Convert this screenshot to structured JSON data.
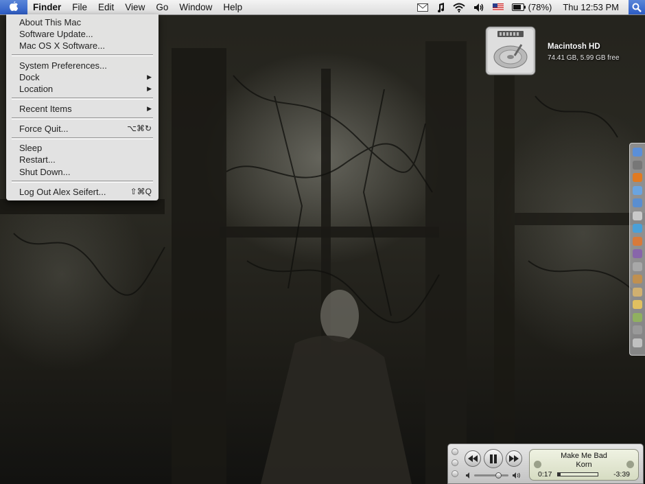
{
  "menubar": {
    "apple_icon": "apple-icon",
    "app_name": "Finder",
    "menus": [
      "File",
      "Edit",
      "View",
      "Go",
      "Window",
      "Help"
    ],
    "extras": {
      "mail_icon": "mail-icon",
      "music_icon": "music-note-icon",
      "wifi_icon": "wifi-icon",
      "volume_icon": "volume-icon",
      "flag_icon": "us-flag-icon",
      "battery_icon": "battery-icon",
      "battery_percent": "(78%)",
      "clock": "Thu 12:53 PM",
      "spotlight_icon": "spotlight-icon"
    }
  },
  "apple_menu": {
    "items": [
      {
        "label": "About This Mac"
      },
      {
        "label": "Software Update..."
      },
      {
        "label": "Mac OS X Software..."
      },
      {
        "label": "System Preferences..."
      },
      {
        "label": "Dock",
        "submenu": true
      },
      {
        "label": "Location",
        "submenu": true
      },
      {
        "label": "Recent Items",
        "submenu": true
      },
      {
        "label": "Force Quit...",
        "shortcut": "⌥⌘↻"
      },
      {
        "label": "Sleep"
      },
      {
        "label": "Restart..."
      },
      {
        "label": "Shut Down..."
      },
      {
        "label": "Log Out Alex Seifert...",
        "shortcut": "⇧⌘Q"
      }
    ]
  },
  "desktop": {
    "hd_name": "Macintosh HD",
    "hd_info": "74.41 GB, 5.99 GB free",
    "hd_icon": "hard-drive-icon"
  },
  "dock": {
    "icons": [
      "finder-icon",
      "system-icon",
      "firefox-icon",
      "safari-icon",
      "mail-icon",
      "ical-icon",
      "itunes-icon",
      "app-icon",
      "app-icon",
      "app-icon",
      "app-icon",
      "app-icon",
      "app-icon",
      "app-icon",
      "app-icon",
      "trash-icon"
    ],
    "colors": [
      "#5b8fd8",
      "#777777",
      "#e07a22",
      "#6aa4e0",
      "#5a8ed0",
      "#c9c9c9",
      "#4aa0d8",
      "#d87a3a",
      "#8866aa",
      "#a8a8a8",
      "#c09050",
      "#d0b070",
      "#e0c060",
      "#90b060",
      "#999999",
      "#c0c0c0"
    ]
  },
  "itunes": {
    "song": "Make Me Bad",
    "artist": "Korn",
    "elapsed": "0:17",
    "remaining": "-3:39",
    "progress": 0.07,
    "volume": 0.7,
    "prev_icon": "rewind-icon",
    "play_icon": "pause-icon",
    "next_icon": "fast-forward-icon"
  }
}
